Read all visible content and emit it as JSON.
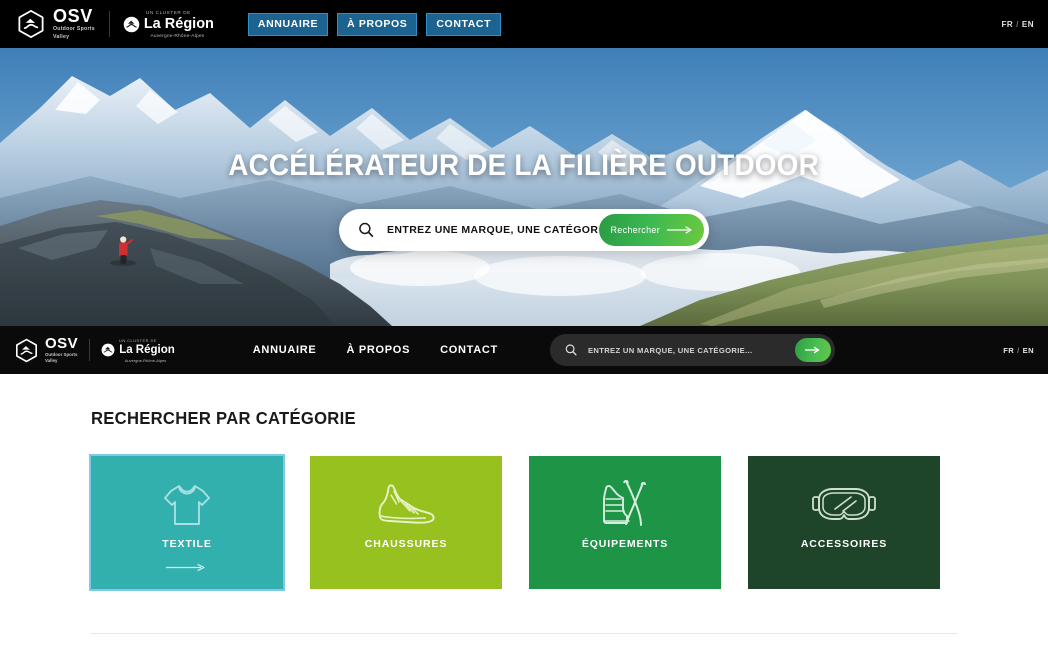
{
  "header": {
    "osv": {
      "title": "OSV",
      "sub_line1": "Outdoor Sports",
      "sub_line2": "Valley",
      "icon": "osv-hexagon-mountain-logo"
    },
    "region": {
      "pre": "UN CLUSTER DE",
      "name": "La Région",
      "sub": "Auvergne-Rhône-Alpes",
      "icon": "la-region-circle-logo"
    },
    "nav": [
      {
        "label": "ANNUAIRE",
        "name": "annuaire"
      },
      {
        "label": "À PROPOS",
        "name": "a-propos"
      },
      {
        "label": "CONTACT",
        "name": "contact"
      }
    ],
    "lang": {
      "fr": "FR",
      "sep": "/",
      "en": "EN"
    },
    "accent_button_bg": "#1d6390",
    "accent_button_border": "#2f8fcb"
  },
  "hero": {
    "title": "ACCÉLÉRATEUR DE LA FILIÈRE OUTDOOR",
    "search": {
      "placeholder": "ENTREZ UNE MARQUE, UNE CATÉGORIE...",
      "value": "",
      "button_label": "Rechercher",
      "icon": "search-icon",
      "button_color": "#3cb952"
    },
    "image_alt": "hiker-on-rocky-ridge-with-snowy-alps"
  },
  "stickynav": {
    "osv": {
      "title": "OSV",
      "sub_line1": "Outdoor Sports",
      "sub_line2": "Valley"
    },
    "region": {
      "pre": "UN CLUSTER DE",
      "name": "La Région",
      "sub": "Auvergne-Rhône-Alpes"
    },
    "links": [
      {
        "label": "ANNUAIRE",
        "name": "annuaire"
      },
      {
        "label": "À PROPOS",
        "name": "a-propos"
      },
      {
        "label": "CONTACT",
        "name": "contact"
      }
    ],
    "search": {
      "placeholder": "ENTREZ UN MARQUE, UNE CATÉGORIE...",
      "value": "",
      "icon": "search-icon"
    },
    "lang": {
      "fr": "FR",
      "sep": "/",
      "en": "EN"
    }
  },
  "categories": {
    "title": "RECHERCHER PAR CATÉGORIE",
    "cards": [
      {
        "label": "TEXTILE",
        "icon": "tshirt-icon",
        "color": "#31b0ae",
        "focused": true,
        "show_arrow": true
      },
      {
        "label": "CHAUSSURES",
        "icon": "sneaker-icon",
        "color": "#96c11f",
        "focused": false,
        "show_arrow": false
      },
      {
        "label": "ÉQUIPEMENTS",
        "icon": "ski-boot-and-skis-icon",
        "color": "#1e9447",
        "focused": false,
        "show_arrow": false
      },
      {
        "label": "ACCESSOIRES",
        "icon": "ski-goggles-icon",
        "color": "#1e4429",
        "focused": false,
        "show_arrow": false
      }
    ]
  }
}
